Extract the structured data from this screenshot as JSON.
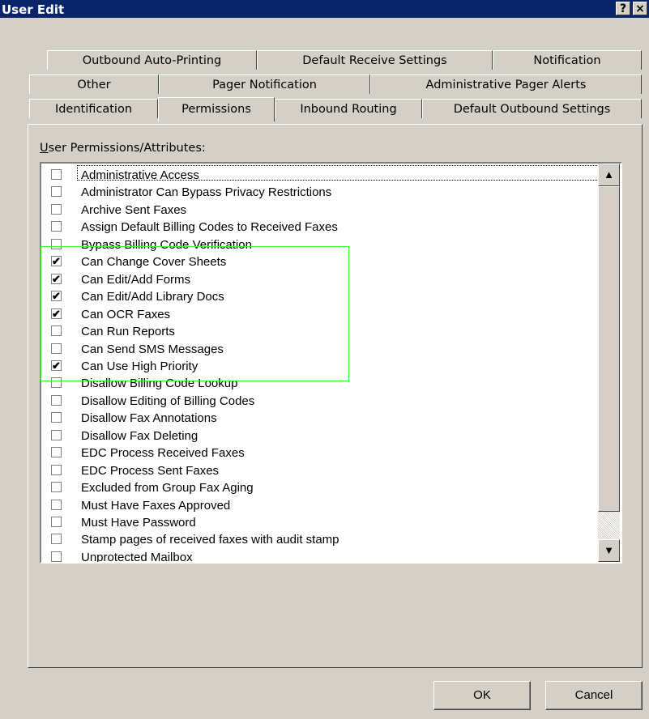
{
  "window": {
    "title": "User Edit",
    "help": "?",
    "close": "×"
  },
  "tabs": {
    "row1": [
      "Outbound Auto-Printing",
      "Default Receive Settings",
      "Notification"
    ],
    "row2": [
      "Other",
      "Pager Notification",
      "Administrative Pager Alerts"
    ],
    "row3": [
      "Identification",
      "Permissions",
      "Inbound Routing",
      "Default Outbound Settings"
    ],
    "active": "Permissions"
  },
  "permissions": {
    "label_accel": "U",
    "label_rest": "ser Permissions/Attributes:",
    "items": [
      {
        "label": "Administrative Access",
        "checked": false
      },
      {
        "label": "Administrator Can Bypass Privacy Restrictions",
        "checked": false
      },
      {
        "label": "Archive Sent Faxes",
        "checked": false
      },
      {
        "label": "Assign Default Billing Codes to Received Faxes",
        "checked": false
      },
      {
        "label": "Bypass Billing Code Verification",
        "checked": false
      },
      {
        "label": "Can Change Cover Sheets",
        "checked": true
      },
      {
        "label": "Can Edit/Add Forms",
        "checked": true
      },
      {
        "label": "Can Edit/Add Library Docs",
        "checked": true
      },
      {
        "label": "Can OCR Faxes",
        "checked": true
      },
      {
        "label": "Can Run Reports",
        "checked": false
      },
      {
        "label": "Can Send SMS Messages",
        "checked": false
      },
      {
        "label": "Can Use High Priority",
        "checked": true
      },
      {
        "label": "Disallow Billing Code Lookup",
        "checked": false
      },
      {
        "label": "Disallow Editing of Billing Codes",
        "checked": false
      },
      {
        "label": "Disallow Fax Annotations",
        "checked": false
      },
      {
        "label": "Disallow Fax Deleting",
        "checked": false
      },
      {
        "label": "EDC Process Received Faxes",
        "checked": false
      },
      {
        "label": "EDC Process Sent Faxes",
        "checked": false
      },
      {
        "label": "Excluded from Group Fax Aging",
        "checked": false
      },
      {
        "label": "Must Have Faxes Approved",
        "checked": false
      },
      {
        "label": "Must Have Password",
        "checked": false
      },
      {
        "label": "Stamp pages of received faxes with audit stamp",
        "checked": false
      },
      {
        "label": "Unprotected Mailbox",
        "checked": false
      }
    ]
  },
  "scrollbar": {
    "up": "▲",
    "down": "▼"
  },
  "buttons": {
    "ok": "OK",
    "cancel": "Cancel"
  },
  "colors": {
    "titlebar": "#0a246a",
    "highlight_box": "#33ff33",
    "dialog_bg": "#d4d0c8"
  }
}
